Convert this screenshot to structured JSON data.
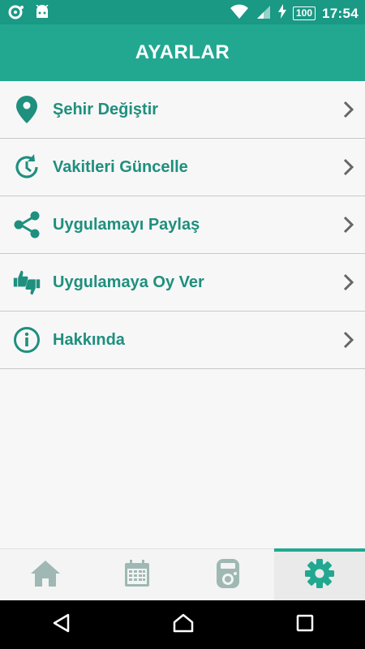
{
  "status_bar": {
    "time": "17:54",
    "battery": "100",
    "icons": [
      "notification-icon",
      "android-icon",
      "wifi-icon",
      "signal-icon",
      "charging-icon",
      "battery-icon"
    ]
  },
  "app_bar": {
    "title": "AYARLAR"
  },
  "menu": {
    "items": [
      {
        "label": "Şehir Değiştir",
        "icon": "location-pin-icon"
      },
      {
        "label": "Vakitleri Güncelle",
        "icon": "refresh-clock-icon"
      },
      {
        "label": "Uygulamayı Paylaş",
        "icon": "share-icon"
      },
      {
        "label": "Uygulamaya Oy Ver",
        "icon": "thumbs-up-down-icon"
      },
      {
        "label": "Hakkında",
        "icon": "info-icon"
      }
    ]
  },
  "bottom_nav": {
    "tabs": [
      {
        "icon": "home-icon",
        "active": false
      },
      {
        "icon": "calendar-icon",
        "active": false
      },
      {
        "icon": "tally-counter-icon",
        "active": false
      },
      {
        "icon": "gear-icon",
        "active": true
      }
    ]
  },
  "colors": {
    "status_bar": "#1a9985",
    "app_bar": "#22a891",
    "accent_text": "#1f8f7e",
    "inactive_nav_icon": "#9fb8b3",
    "active_nav_icon": "#22a891"
  }
}
